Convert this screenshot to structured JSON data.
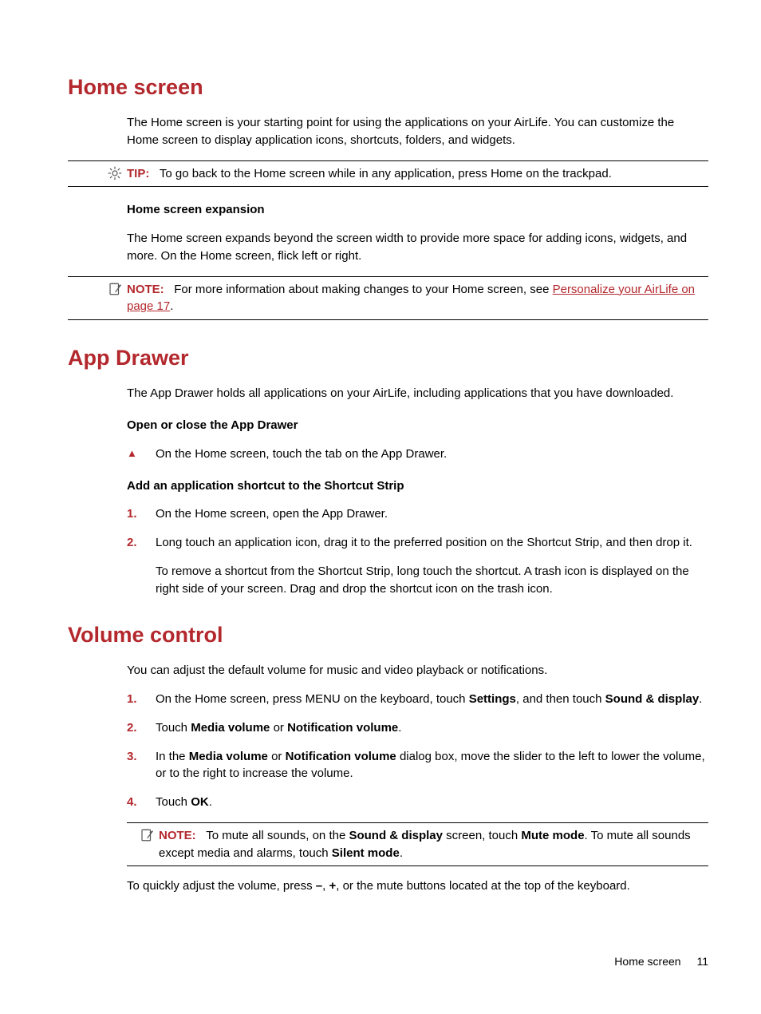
{
  "section1": {
    "title": "Home screen",
    "intro": "The Home screen is your starting point for using the applications on your AirLife. You can customize the Home screen to display application icons, shortcuts, folders, and widgets.",
    "tip_label": "TIP:",
    "tip_text": "To go back to the Home screen while in any application, press Home on the trackpad.",
    "sub1_title": "Home screen expansion",
    "sub1_text": "The Home screen expands beyond the screen width to provide more space for adding icons, widgets, and more. On the Home screen, flick left or right.",
    "note_label": "NOTE:",
    "note_pre": "For more information about making changes to your Home screen, see ",
    "note_link": "Personalize your AirLife on page 17",
    "note_post": "."
  },
  "section2": {
    "title": "App Drawer",
    "intro": "The App Drawer holds all applications on your AirLife, including applications that you have downloaded.",
    "sub1_title": "Open or close the App Drawer",
    "sub1_bullet": "On the Home screen, touch the tab on the App Drawer.",
    "sub2_title": "Add an application shortcut to the Shortcut Strip",
    "steps": [
      {
        "n": "1.",
        "t": "On the Home screen, open the App Drawer."
      },
      {
        "n": "2.",
        "t": "Long touch an application icon, drag it to the preferred position on the Shortcut Strip, and then drop it.",
        "extra": "To remove a shortcut from the Shortcut Strip, long touch the shortcut. A trash icon is displayed on the right side of your screen. Drag and drop the shortcut icon on the trash icon."
      }
    ]
  },
  "section3": {
    "title": "Volume control",
    "intro": "You can adjust the default volume for music and video playback or notifications.",
    "steps": {
      "s1": {
        "n": "1.",
        "pre": "On the Home screen, press MENU on the keyboard, touch ",
        "b1": "Settings",
        "mid": ", and then touch ",
        "b2": "Sound & display",
        "post": "."
      },
      "s2": {
        "n": "2.",
        "pre": "Touch ",
        "b1": "Media volume",
        "mid": " or ",
        "b2": "Notification volume",
        "post": "."
      },
      "s3": {
        "n": "3.",
        "pre": "In the ",
        "b1": "Media volume",
        "mid": " or ",
        "b2": "Notification volume",
        "post": " dialog box, move the slider to the left to lower the volume, or to the right to increase the volume."
      },
      "s4": {
        "n": "4.",
        "pre": "Touch ",
        "b1": "OK",
        "post": "."
      }
    },
    "note_label": "NOTE:",
    "note": {
      "pre": "To mute all sounds, on the ",
      "b1": "Sound & display",
      "mid1": " screen, touch ",
      "b2": "Mute mode",
      "mid2": ". To mute all sounds except media and alarms, touch ",
      "b3": "Silent mode",
      "post": "."
    },
    "outro": {
      "pre": "To quickly adjust the volume, press ",
      "b1": "–",
      "c1": ", ",
      "b2": "+",
      "post": ", or the mute buttons located at the top of the keyboard."
    }
  },
  "footer": {
    "label": "Home screen",
    "page": "11"
  }
}
